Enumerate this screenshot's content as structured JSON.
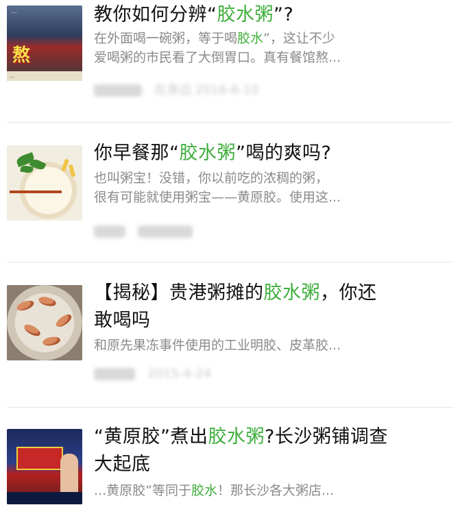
{
  "articles": [
    {
      "thumb": "article-thumbnail-1",
      "title_pre": "教你如何分辨“",
      "title_hl": "胶水粥",
      "title_post": "”?",
      "title_line2": "",
      "snippet_line1_pre": "在外面喝一碗粥，等于喝",
      "snippet_line1_hl": "胶水",
      "snippet_line1_post": "”，这让不少",
      "snippet_line2": "爱喝粥的市民看了大倒胃口。真有餐馆熬...",
      "meta": "在身边 2016-6-10"
    },
    {
      "thumb": "article-thumbnail-2",
      "title_pre": "你早餐那“",
      "title_hl": "胶水粥",
      "title_post": "”喝的爽吗?",
      "title_line2": "",
      "snippet_line1_pre": "也叫粥宝！没错，你以前吃的浓稠的粥，",
      "snippet_line1_hl": "",
      "snippet_line1_post": "",
      "snippet_line2": "很有可能就使用粥宝——黄原胶。使用这...",
      "meta": ""
    },
    {
      "thumb": "article-thumbnail-3",
      "title_pre": "【揭秘】贵港粥摊的",
      "title_hl": "胶水粥",
      "title_post": "，你还",
      "title_line2": "敢喝吗",
      "snippet_line1_pre": "和原先果冻事件使用的工业明胶、皮革胶...",
      "snippet_line1_hl": "",
      "snippet_line1_post": "",
      "snippet_line2": "",
      "meta": "2015-4-24"
    },
    {
      "thumb": "article-thumbnail-4",
      "title_pre": "“黄原胶”煮出",
      "title_hl": "胶水粥",
      "title_post": "?长沙粥铺调查",
      "title_line2": "大起底",
      "snippet_line1_pre": "...黄原胶”等同于",
      "snippet_line1_hl": "胶水",
      "snippet_line1_post": "！那长沙各大粥店...",
      "snippet_line2": "",
      "meta": ""
    }
  ],
  "thumb_text": {
    "t1_hot": "熬",
    "t1_top": "...",
    "t1_bottom": "..."
  },
  "colors": {
    "highlight": "#3fae3c",
    "title": "#111111",
    "snippet": "#8a8a8a"
  }
}
